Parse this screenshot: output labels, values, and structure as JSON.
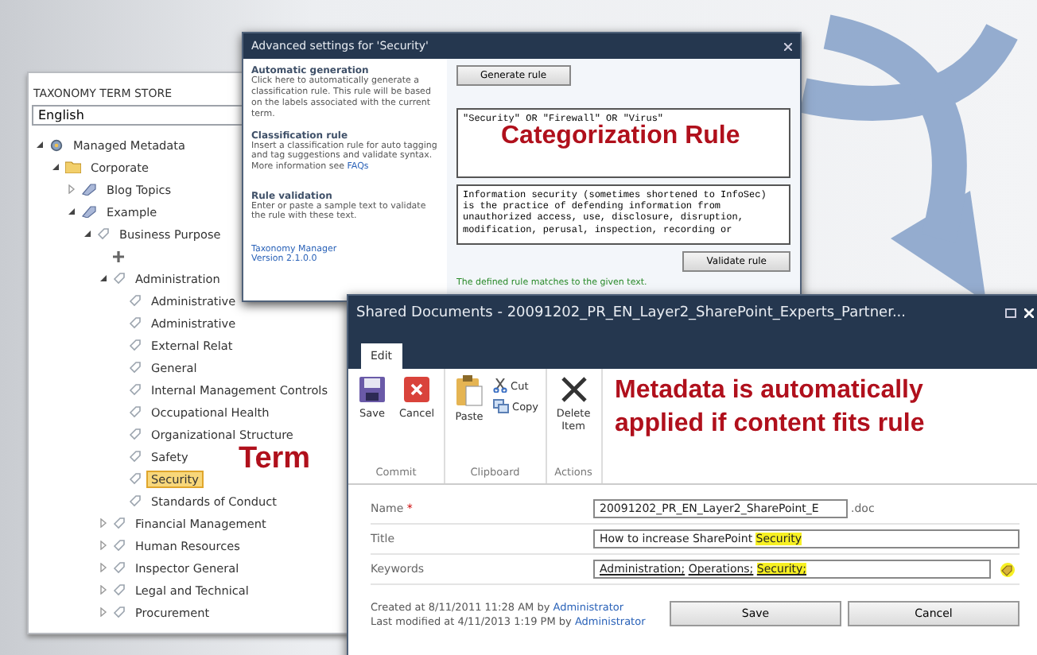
{
  "term_store": {
    "title": "TAXONOMY TERM STORE",
    "language": "English",
    "tree": [
      {
        "label": "Managed Metadata",
        "kind": "store",
        "expanded": true,
        "selected": false,
        "children": [
          {
            "label": "Corporate",
            "kind": "group",
            "expanded": true,
            "selected": false,
            "children": [
              {
                "label": "Blog Topics",
                "kind": "termset",
                "expanded": false,
                "selected": false
              },
              {
                "label": "Example",
                "kind": "termset",
                "expanded": true,
                "selected": false,
                "children": [
                  {
                    "label": "Business Purpose",
                    "kind": "term",
                    "expanded": true,
                    "selected": false,
                    "add_row": true,
                    "children": [
                      {
                        "label": "Administration",
                        "kind": "term",
                        "expanded": true,
                        "selected": false,
                        "children": [
                          {
                            "label": "Administrative",
                            "kind": "term",
                            "selected": false
                          },
                          {
                            "label": "Administrative",
                            "kind": "term",
                            "selected": false
                          },
                          {
                            "label": "External Relat",
                            "kind": "term",
                            "selected": false
                          },
                          {
                            "label": "General",
                            "kind": "term",
                            "selected": false
                          },
                          {
                            "label": "Internal Management Controls",
                            "kind": "term",
                            "selected": false
                          },
                          {
                            "label": "Occupational Health",
                            "kind": "term",
                            "selected": false
                          },
                          {
                            "label": "Organizational Structure",
                            "kind": "term",
                            "selected": false
                          },
                          {
                            "label": "Safety",
                            "kind": "term",
                            "selected": false
                          },
                          {
                            "label": "Security",
                            "kind": "term",
                            "selected": true
                          },
                          {
                            "label": "Standards of Conduct",
                            "kind": "term",
                            "selected": false
                          }
                        ]
                      },
                      {
                        "label": "Financial Management",
                        "kind": "term",
                        "expanded": false,
                        "selected": false
                      },
                      {
                        "label": "Human Resources",
                        "kind": "term",
                        "expanded": false,
                        "selected": false
                      },
                      {
                        "label": "Inspector General",
                        "kind": "term",
                        "expanded": false,
                        "selected": false
                      },
                      {
                        "label": "Legal and Technical",
                        "kind": "term",
                        "expanded": false,
                        "selected": false
                      },
                      {
                        "label": "Procurement",
                        "kind": "term",
                        "expanded": false,
                        "selected": false
                      }
                    ]
                  }
                ]
              }
            ]
          }
        ]
      }
    ],
    "callout": "Term"
  },
  "settings_dialog": {
    "title": "Advanced settings for 'Security'",
    "sections": [
      {
        "heading": "Automatic generation",
        "text": "Click here to automatically generate a classification rule. This rule will be based on the labels associated with the current term.",
        "kind": "button",
        "button": "Generate rule"
      },
      {
        "heading": "Classification rule",
        "text": "Insert a classification rule for auto tagging and tag suggestions and validate syntax. More information see",
        "link": "FAQs",
        "kind": "textarea",
        "value": "\"Security\" OR \"Firewall\" OR \"Virus\""
      },
      {
        "heading": "Rule validation",
        "text": "Enter or paste a sample text to validate the rule with these text.",
        "kind": "textarea",
        "value": "Information security (sometimes shortened to InfoSec) is the practice of defending information from unauthorized access, use, disclosure, disruption, modification, perusal, inspection, recording or"
      }
    ],
    "validate_button": "Validate rule",
    "message": "The defined rule matches to the given text.",
    "footer": "Taxonomy Manager Version 2.1.0.0",
    "callout": "Categorization Rule"
  },
  "edit_dialog": {
    "title": "Shared Documents - 20091202_PR_EN_Layer2_SharePoint_Experts_Partner...",
    "tabs": [
      {
        "label": "Edit",
        "selected": true
      }
    ],
    "groups": [
      {
        "label": "Commit",
        "items": [
          {
            "label": "Save",
            "kind": "save"
          },
          {
            "label": "Cancel",
            "kind": "cancel"
          }
        ]
      },
      {
        "label": "Clipboard",
        "items": [
          {
            "label": "Paste",
            "kind": "paste"
          },
          {
            "label": "Cut",
            "kind": "cut"
          },
          {
            "label": "Copy",
            "kind": "copy"
          }
        ]
      },
      {
        "label": "Actions",
        "items": [
          {
            "label": "Delete Item",
            "kind": "delete"
          }
        ]
      }
    ],
    "callout": "Metadata is automatically applied if content fits rule",
    "fields": [
      {
        "label": "Name",
        "required_mark": "*",
        "kind": "name",
        "value": "20091202_PR_EN_Layer2_SharePoint_E",
        "suffix": ".doc"
      },
      {
        "label": "Title",
        "kind": "text",
        "parts": [
          {
            "text": "How to increase SharePoint",
            "highlighted": false
          },
          {
            "text": "Security",
            "highlighted": true
          }
        ]
      },
      {
        "label": "Keywords",
        "kind": "keywords",
        "parts": [
          {
            "text": "Administration;",
            "highlighted": false
          },
          {
            "text": "Operations;",
            "highlighted": false
          },
          {
            "text": "Security;",
            "highlighted": true
          }
        ]
      }
    ],
    "created": {
      "text": "Created at 8/11/2011 11:28 AM by",
      "user": "Administrator"
    },
    "modified": {
      "text": "Last modified at 4/11/2013 1:19 PM by",
      "user": "Administrator"
    },
    "buttons": [
      "Save",
      "Cancel"
    ]
  }
}
